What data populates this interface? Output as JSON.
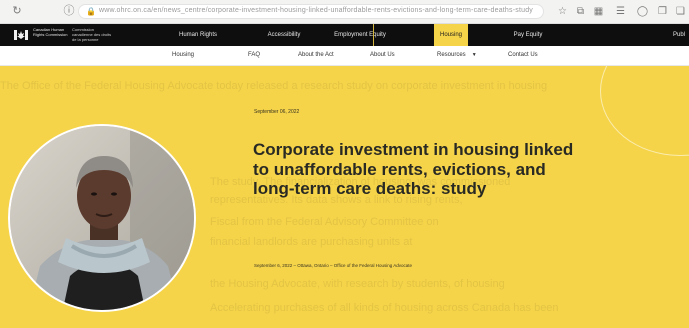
{
  "browser": {
    "url": "www.ohrc.on.ca/en/news_centre/corporate-investment-housing-linked-unaffordable-rents-evictions-and-long-term-care-deaths-study",
    "icons": [
      "refresh-icon",
      "info-icon",
      "lock-icon",
      "star-icon",
      "share-icon",
      "extensions-icon",
      "menu-icon",
      "profile-icon",
      "tab-icon"
    ]
  },
  "header": {
    "logo_line_1": "Canadian Human Rights Commission",
    "logo_line_2": "Commission canadienne des droits de la personne",
    "nav": [
      {
        "label": "Human Rights",
        "active": false
      },
      {
        "label": "Accessibility",
        "active": false
      },
      {
        "label": "Employment Equity",
        "active": false
      },
      {
        "label": "Housing",
        "active": true
      },
      {
        "label": "Pay Equity",
        "active": false
      },
      {
        "label": "Publ",
        "active": false
      }
    ]
  },
  "subnav": {
    "items": [
      "Housing",
      "FAQ",
      "About the Act",
      "About Us",
      "Resources",
      "Contact Us"
    ]
  },
  "hero": {
    "date": "September 06, 2022",
    "title": "Corporate investment in housing linked to unaffordable rents, evictions, and long-term care deaths: study",
    "byline": "September 6, 2022 – Ottawa, Ontario – Office of the Federal Housing Advocate",
    "ghost_lines": [
      "The Office of the Federal Housing Advocate today released a research study on corporate investment in housing",
      "The study, The financialization of housing, was commissioned",
      "representatives. Its data shows a link to rising rents,",
      "Fiscal from the Federal Advisory Committee on",
      "financial landlords are purchasing units at",
      "the Housing Advocate, with research by students, of housing",
      "Accelerating purchases of all kinds of housing across Canada has been"
    ]
  },
  "colors": {
    "header_bg": "#0e0e0e",
    "accent_yellow": "#f5d44a",
    "active_nav": "#f6d44a",
    "title_text": "#2a2a24"
  }
}
